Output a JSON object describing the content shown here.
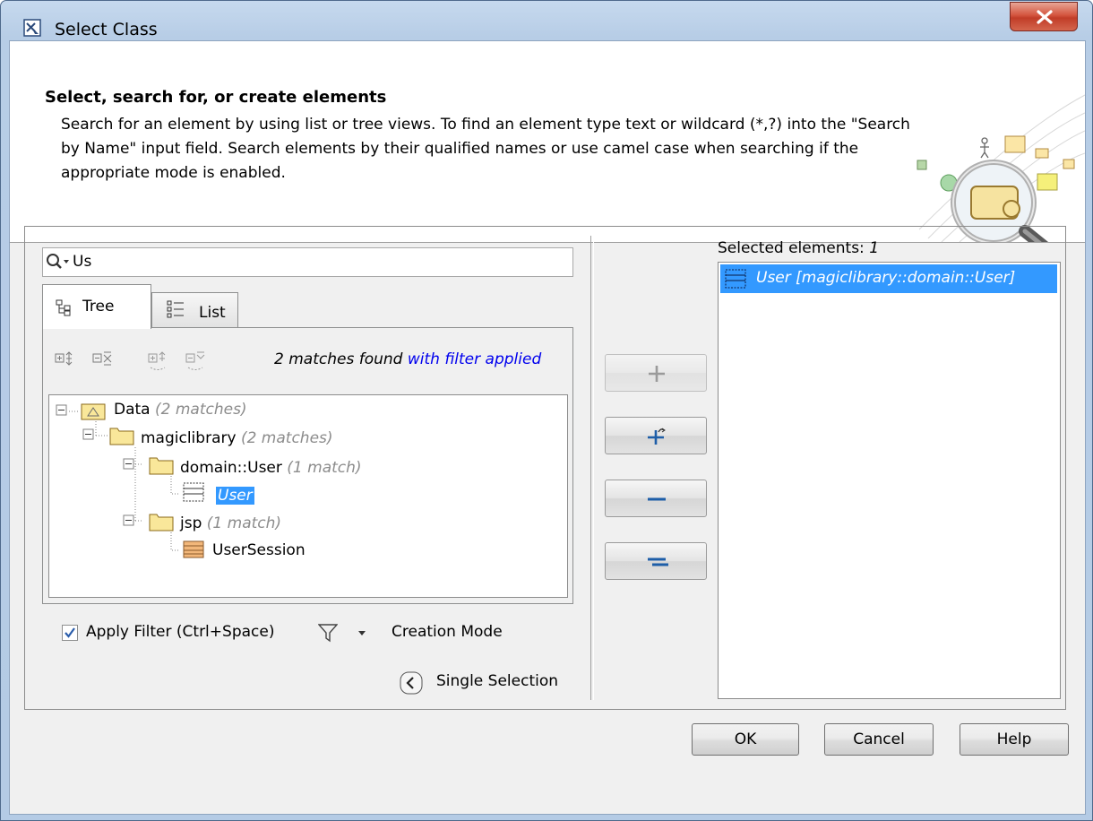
{
  "window": {
    "title": "Select Class"
  },
  "header": {
    "title": "Select, search for, or create elements",
    "description": "Search for an element by using list or tree views. To find an element type text or wildcard (*,?) into the \"Search by Name\" input field. Search elements by their qualified names or use camel case when searching if the appropriate mode is enabled."
  },
  "search": {
    "value": "Us"
  },
  "tabs": {
    "tree": "Tree",
    "list": "List"
  },
  "tree_panel": {
    "match_count": "2 matches found",
    "match_filter": "with filter applied",
    "nodes": [
      {
        "label": "Data",
        "hint": "(2 matches)"
      },
      {
        "label": "magiclibrary",
        "hint": "(2 matches)"
      },
      {
        "label": "domain::User",
        "hint": "(1 match)"
      },
      {
        "label": "User",
        "hint": ""
      },
      {
        "label": "jsp",
        "hint": "(1 match)"
      },
      {
        "label": "UserSession",
        "hint": ""
      }
    ]
  },
  "filter": {
    "apply_label": "Apply Filter (Ctrl+Space)",
    "apply_checked": true,
    "creation_mode": "Creation Mode",
    "single_selection": "Single Selection"
  },
  "selected": {
    "label": "Selected elements:",
    "count": "1",
    "items": [
      {
        "label": "User [magiclibrary::domain::User]"
      }
    ]
  },
  "buttons": {
    "ok": "OK",
    "cancel": "Cancel",
    "help": "Help"
  },
  "colors": {
    "selection": "#3399ff",
    "link_blue": "#0000ee",
    "hint_gray": "#8c8c8c",
    "close_red": "#c13d28"
  }
}
